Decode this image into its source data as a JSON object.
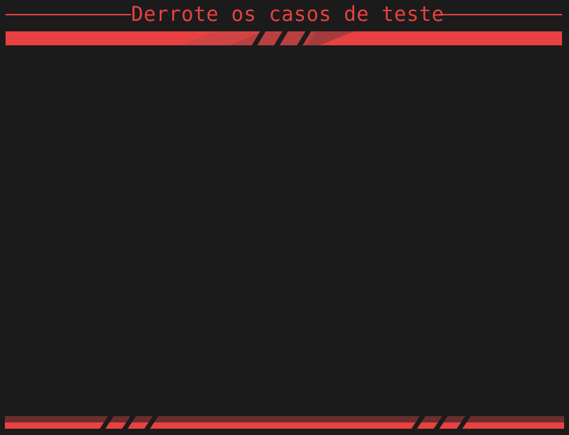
{
  "header": {
    "title": "Derrote os casos de teste"
  },
  "theme": {
    "background": "#1b1b1b",
    "accent": "#e84142",
    "accent_dim": "#a33a3a",
    "accent_dark": "#5a2a2a"
  }
}
